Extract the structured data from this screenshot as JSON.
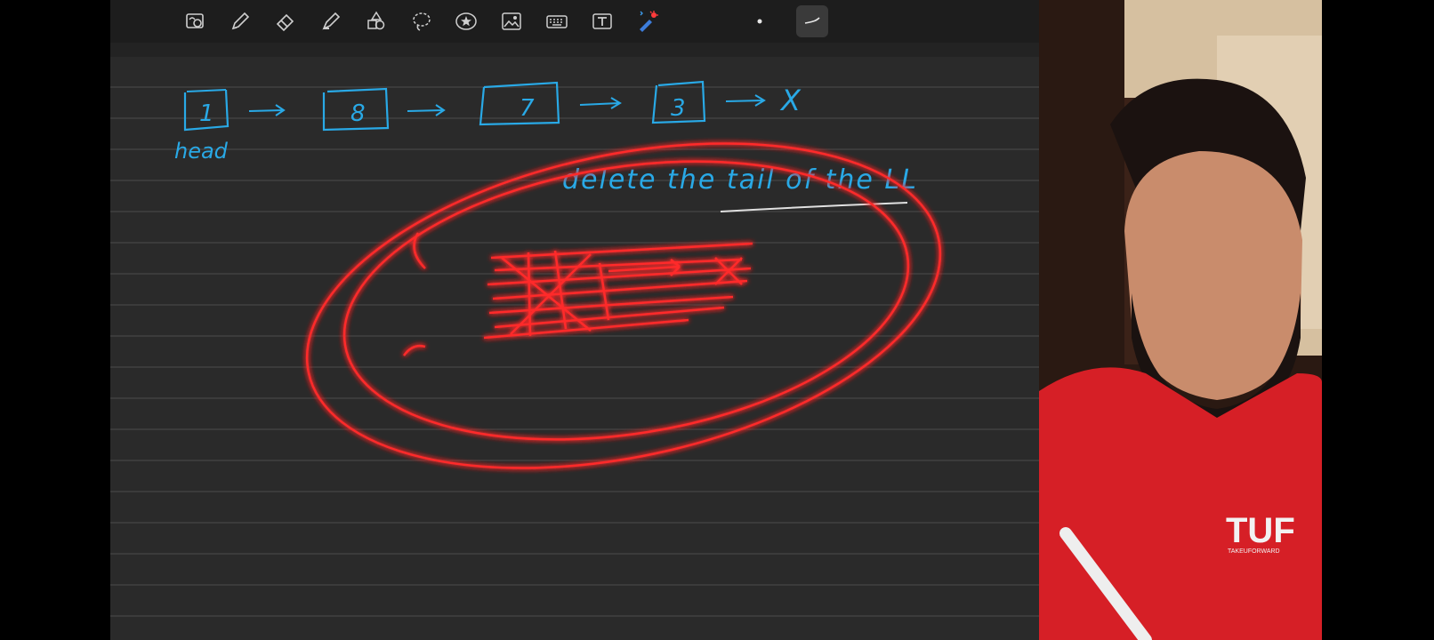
{
  "toolbar": {
    "tools": [
      {
        "name": "zoom-window-icon"
      },
      {
        "name": "pen-icon"
      },
      {
        "name": "eraser-icon"
      },
      {
        "name": "highlighter-icon"
      },
      {
        "name": "shapes-icon"
      },
      {
        "name": "lasso-icon"
      },
      {
        "name": "sticker-icon"
      },
      {
        "name": "image-icon"
      },
      {
        "name": "keyboard-icon"
      },
      {
        "name": "text-box-icon"
      },
      {
        "name": "laser-pointer-icon"
      },
      {
        "name": "pen-size-dot-icon"
      },
      {
        "name": "stroke-style-icon"
      }
    ],
    "selected_tool": "stroke-style-icon"
  },
  "notes": {
    "nodes": [
      "1",
      "8",
      "7",
      "3"
    ],
    "null_marker": "X",
    "head_label": "head",
    "caption": "delete the tail of the LL",
    "ink_color": "#29a9e6",
    "laser_color": "#ff2a2a"
  },
  "webcam": {
    "shirt_logo": "TUF",
    "shirt_logo_sub": "TAKEUFORWARD"
  }
}
